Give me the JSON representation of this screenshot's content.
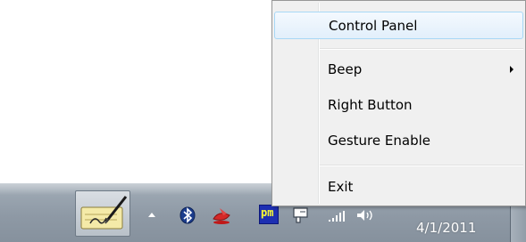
{
  "context_menu": {
    "items": [
      {
        "label": "Control Panel",
        "highlighted": true
      },
      {
        "label": "Beep",
        "has_submenu": true
      },
      {
        "label": "Right Button"
      },
      {
        "label": "Gesture Enable"
      },
      {
        "label": "Exit"
      }
    ]
  },
  "taskbar": {
    "pinned": [
      {
        "icon": "pen-tablet-icon"
      }
    ],
    "tray_icons": [
      {
        "icon": "show-hidden-icons-arrow-icon"
      },
      {
        "icon": "bluetooth-icon"
      },
      {
        "icon": "red-lips-app-icon"
      },
      {
        "icon": "pm-app-icon",
        "text": "pm"
      },
      {
        "icon": "device-app-icon"
      },
      {
        "icon": "network-signal-icon"
      },
      {
        "icon": "speaker-volume-icon"
      }
    ],
    "clock": {
      "date": "4/1/2011"
    }
  }
}
